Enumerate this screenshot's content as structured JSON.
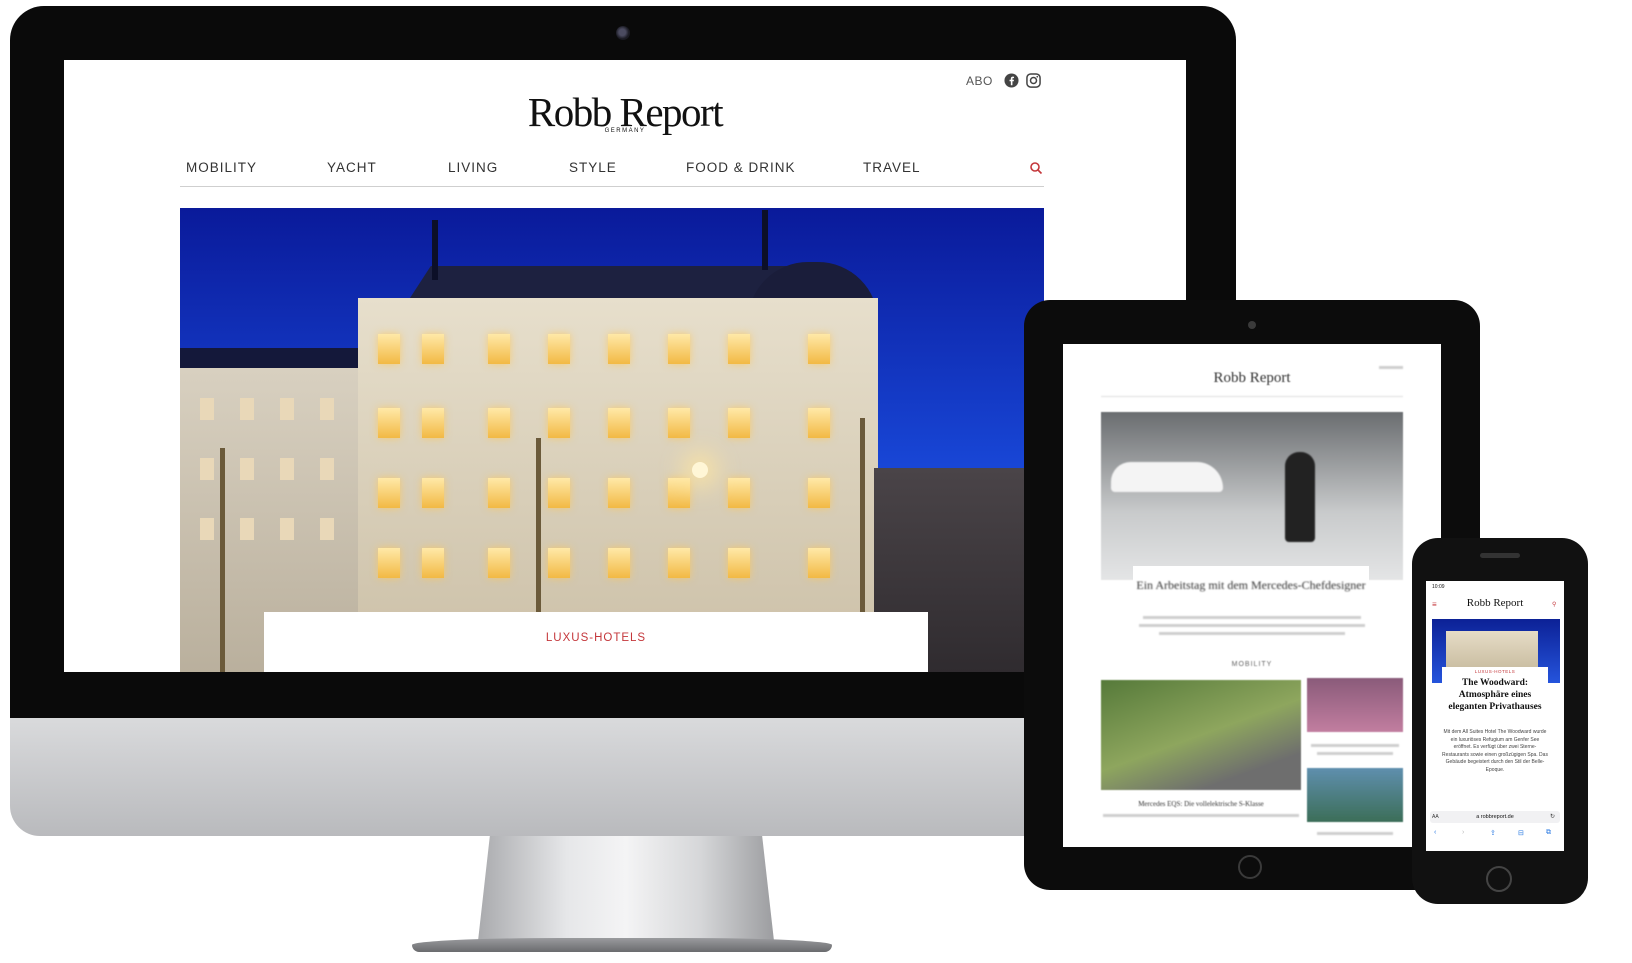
{
  "desktop": {
    "logo": "Robb Report",
    "logo_sub": "GERMANY",
    "abo": "ABO",
    "nav": [
      "MOBILITY",
      "YACHT",
      "LIVING",
      "STYLE",
      "FOOD & DRINK",
      "TRAVEL"
    ],
    "hero_kicker": "LUXUS-HOTELS",
    "accent_color": "#c4373b"
  },
  "tablet": {
    "logo": "Robb Report",
    "headline": "Ein Arbeitstag mit dem Mercedes-Chefdesigner",
    "section": "MOBILITY",
    "caption": "Mercedes EQS: Die vollelektrische S-Klasse"
  },
  "phone": {
    "time": "10:09",
    "logo": "Robb Report",
    "menu_icon": "≡",
    "search_icon": "⚲",
    "kicker": "LUXUS-HOTELS",
    "headline": "The Woodward: Atmosphäre eines eleganten Privathauses",
    "body": "Mit dem All Suites Hotel The Woodward wurde ein luxuriöses Refugium am Genfer See eröffnet. Es verfügt über zwei Sterne-Restaurants sowie einen großzügigen Spa. Das Gebäude begeistert durch den Stil der Belle-Epoque.",
    "aa": "AA",
    "url": "a robbreport.de",
    "reload": "↻",
    "tools": [
      "‹",
      "›",
      "⇪",
      "⊟",
      "⧉"
    ]
  }
}
